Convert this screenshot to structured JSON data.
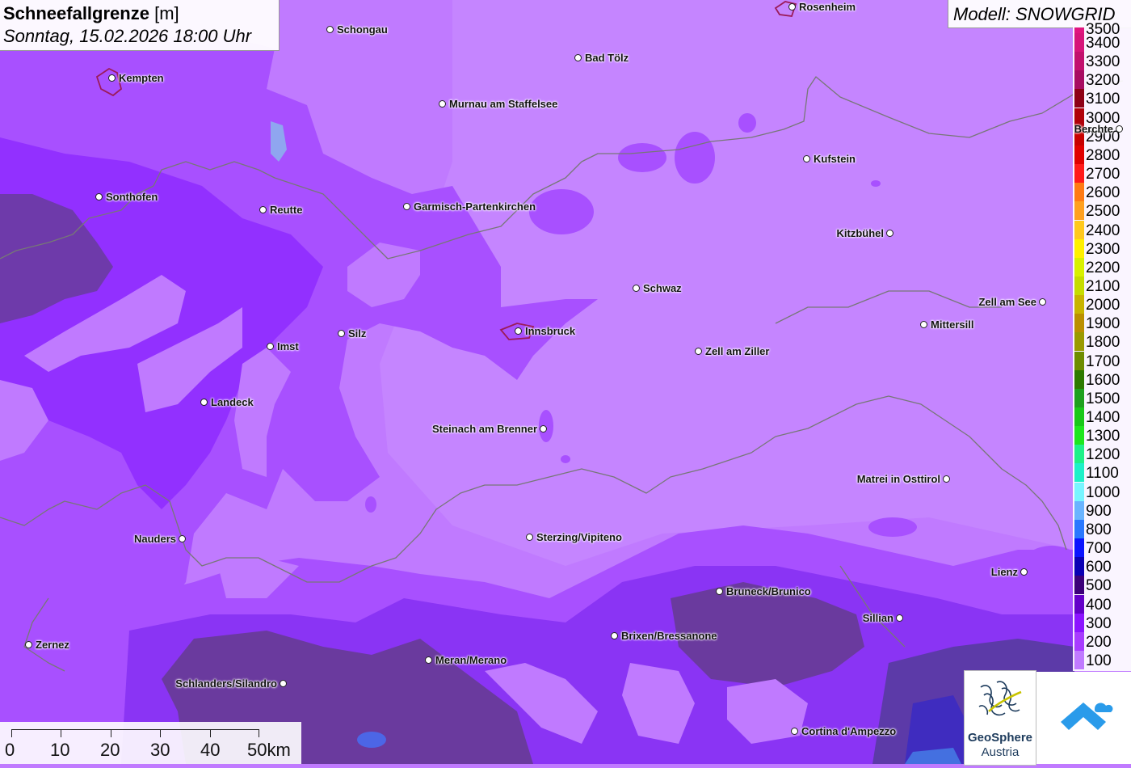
{
  "title": {
    "bold": "Schneefallgrenze",
    "unit": "[m]",
    "datetime": "Sonntag, 15.02.2026 18:00 Uhr"
  },
  "model": "Modell: SNOWGRID",
  "legend": {
    "top_partial": "3500",
    "items": [
      {
        "label": "3400",
        "color": "#d6147a"
      },
      {
        "label": "3300",
        "color": "#c2106e"
      },
      {
        "label": "3200",
        "color": "#a80c62"
      },
      {
        "label": "3100",
        "color": "#8e0016"
      },
      {
        "label": "3000",
        "color": "#b0000a"
      },
      {
        "label": "2900",
        "color": "#c80000"
      },
      {
        "label": "2800",
        "color": "#e00000"
      },
      {
        "label": "2700",
        "color": "#ff1a1a"
      },
      {
        "label": "2600",
        "color": "#ff7a14"
      },
      {
        "label": "2500",
        "color": "#ffa020"
      },
      {
        "label": "2400",
        "color": "#ffc81e"
      },
      {
        "label": "2300",
        "color": "#fff000"
      },
      {
        "label": "2200",
        "color": "#d8f000"
      },
      {
        "label": "2100",
        "color": "#c6dc00"
      },
      {
        "label": "2000",
        "color": "#c8b400"
      },
      {
        "label": "1900",
        "color": "#bb8f00"
      },
      {
        "label": "1800",
        "color": "#9a9a00"
      },
      {
        "label": "1700",
        "color": "#6e8c00"
      },
      {
        "label": "1600",
        "color": "#2d7a00"
      },
      {
        "label": "1500",
        "color": "#1ea01e"
      },
      {
        "label": "1400",
        "color": "#19c819"
      },
      {
        "label": "1300",
        "color": "#1ee61e"
      },
      {
        "label": "1200",
        "color": "#1ef088"
      },
      {
        "label": "1100",
        "color": "#1ef0c8"
      },
      {
        "label": "1000",
        "color": "#78f5ff"
      },
      {
        "label": "900",
        "color": "#6ab4ff"
      },
      {
        "label": "800",
        "color": "#2a78ff"
      },
      {
        "label": "700",
        "color": "#0a14ff"
      },
      {
        "label": "600",
        "color": "#0a00b4"
      },
      {
        "label": "500",
        "color": "#3c007a"
      },
      {
        "label": "400",
        "color": "#6400c8"
      },
      {
        "label": "300",
        "color": "#8c14ff"
      },
      {
        "label": "200",
        "color": "#a83cff"
      },
      {
        "label": "100",
        "color": "#c07aff"
      }
    ]
  },
  "cities": [
    {
      "name": "Rosenheim",
      "side": "right"
    },
    {
      "name": "Schongau",
      "side": "right"
    },
    {
      "name": "Bad Tölz",
      "side": "right"
    },
    {
      "name": "Kempten",
      "side": "right"
    },
    {
      "name": "Murnau am Staffelsee",
      "side": "right"
    },
    {
      "name": "Berchte",
      "side": "left"
    },
    {
      "name": "Kufstein",
      "side": "right"
    },
    {
      "name": "Sonthofen",
      "side": "right"
    },
    {
      "name": "Reutte",
      "side": "right"
    },
    {
      "name": "Garmisch-Partenkirchen",
      "side": "right"
    },
    {
      "name": "Kitzbühel",
      "side": "left"
    },
    {
      "name": "Schwaz",
      "side": "right"
    },
    {
      "name": "Zell am See",
      "side": "left"
    },
    {
      "name": "Mittersill",
      "side": "right"
    },
    {
      "name": "Innsbruck",
      "side": "right"
    },
    {
      "name": "Silz",
      "side": "right"
    },
    {
      "name": "Imst",
      "side": "right"
    },
    {
      "name": "Zell am Ziller",
      "side": "right"
    },
    {
      "name": "Landeck",
      "side": "right"
    },
    {
      "name": "Steinach am Brenner",
      "side": "left"
    },
    {
      "name": "Matrei in Osttirol",
      "side": "left"
    },
    {
      "name": "Nauders",
      "side": "left"
    },
    {
      "name": "Sterzing/Vipiteno",
      "side": "right"
    },
    {
      "name": "Lienz",
      "side": "left"
    },
    {
      "name": "Bruneck/Brunico",
      "side": "right"
    },
    {
      "name": "Sillian",
      "side": "left"
    },
    {
      "name": "Brixen/Bressanone",
      "side": "right"
    },
    {
      "name": "Zernez",
      "side": "right"
    },
    {
      "name": "Meran/Merano",
      "side": "right"
    },
    {
      "name": "Schlanders/Silandro",
      "side": "left"
    },
    {
      "name": "Cortina d'Ampezzo",
      "side": "right"
    }
  ],
  "scale": [
    "0",
    "10",
    "20",
    "30",
    "40",
    "50km"
  ],
  "logos": {
    "geosphere_1": "GeoSphere",
    "geosphere_2": "Austria"
  }
}
